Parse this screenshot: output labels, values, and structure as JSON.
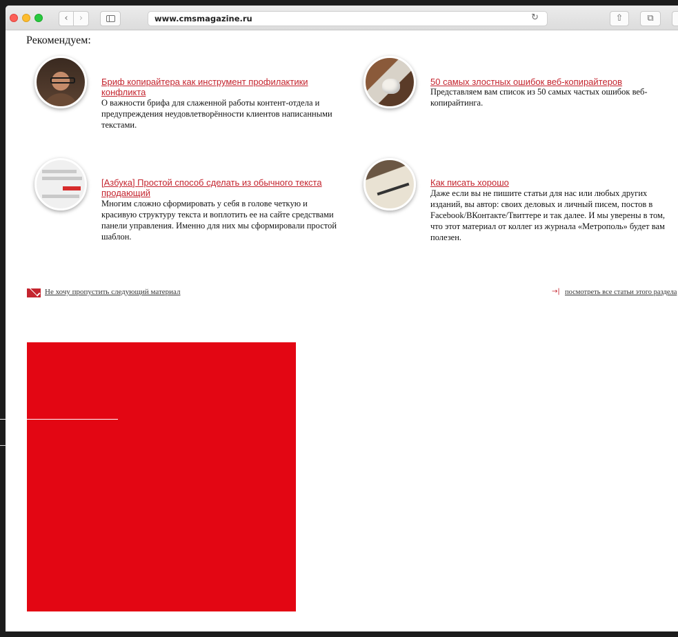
{
  "browser": {
    "url": "www.cmsmagazine.ru",
    "back_glyph": "‹",
    "forward_glyph": "›",
    "reload_glyph": "↻",
    "share_glyph": "⇧",
    "tabs_glyph": "⧉"
  },
  "section_title": "Рекомендуем:",
  "articles": [
    {
      "title": "Бриф копирайтера как инструмент профилактики конфликта",
      "description": "О важности брифа для слаженной работы контент-отдела и предупреждения неудовлетворённости клиентов написанными текстами."
    },
    {
      "title": "50 самых злостных ошибок веб-копирайтеров",
      "description": "Представляем вам список из 50 самых частых ошибок веб-копирайтинга."
    },
    {
      "title": "[Азбука] Простой способ сделать из обычного текста продающий",
      "description": "Многим сложно сформировать у себя в голове четкую и красивую структуру текста и воплотить ее на сайте средствами панели управления. Именно для них мы сформировали простой шаблон."
    },
    {
      "title": "Как писать хорошо",
      "description": "Даже если вы не пишите статьи для нас или любых других изданий, вы автор: своих деловых и личный писем, постов в Facebook/ВКонтакте/Твиттере и так далее. И мы уверены в том, что этот материал от коллег из журнала «Метрополь» будет вам полезен."
    }
  ],
  "subscribe_link": "Не хочу пропустить следующий материал",
  "all_articles_arrow": "→|",
  "all_articles_link": "посмотреть все статьи этого раздела",
  "colors": {
    "accent": "#c4242e",
    "promo_block": "#e30613"
  }
}
